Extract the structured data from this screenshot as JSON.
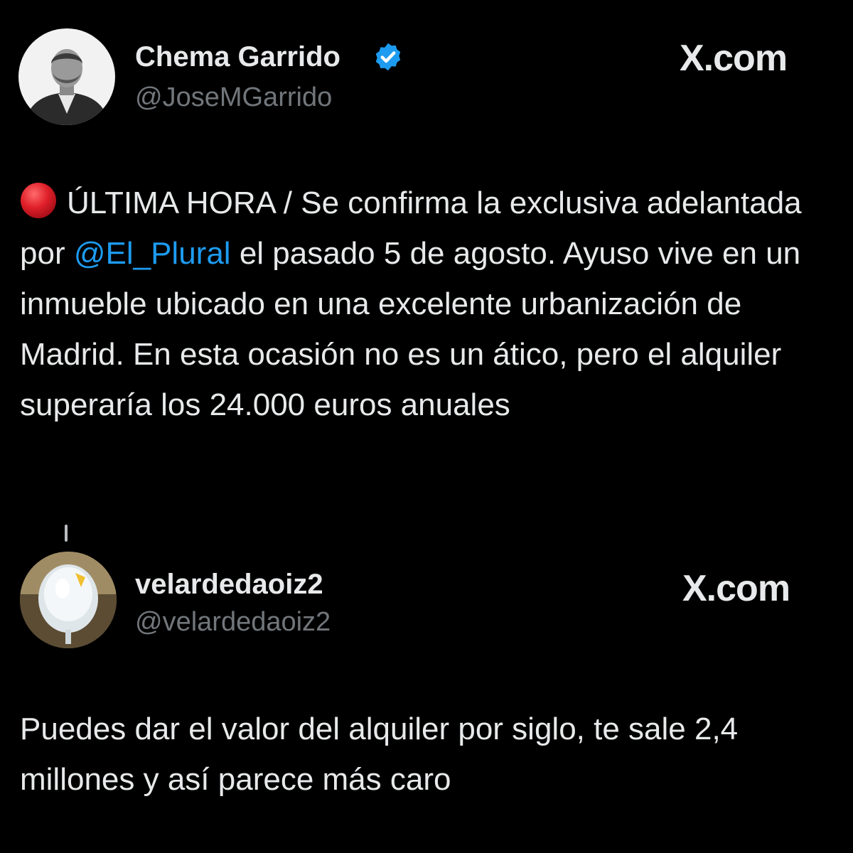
{
  "original_post": {
    "display_name": "Chema Garrido",
    "handle": "@JoseMGarrido",
    "verified": true,
    "source_logo": "X.com",
    "text_before_mention": "ÚLTIMA HORA / Se confirma la exclusiva adelantada por ",
    "mention": "@El_Plural",
    "text_after_mention": " el pasado 5 de agosto. Ayuso vive en un inmueble ubicado en una excelente urbanización de Madrid. En esta ocasión no es un ático, pero el alquiler superaría los 24.000 euros anuales",
    "leading_icon": "red-circle-icon"
  },
  "reply_post": {
    "display_name": "velardedaoiz2",
    "handle": "@velardedaoiz2",
    "source_logo": "X.com",
    "text": "Puedes dar el valor del alquiler por siglo, te sale 2,4 millones y así parece más caro"
  },
  "colors": {
    "background": "#000000",
    "text": "#e7e9ea",
    "secondary_text": "#71767b",
    "mention": "#1d9bf0",
    "verified_badge": "#1d9bf0",
    "red_dot": "#e0202a"
  }
}
